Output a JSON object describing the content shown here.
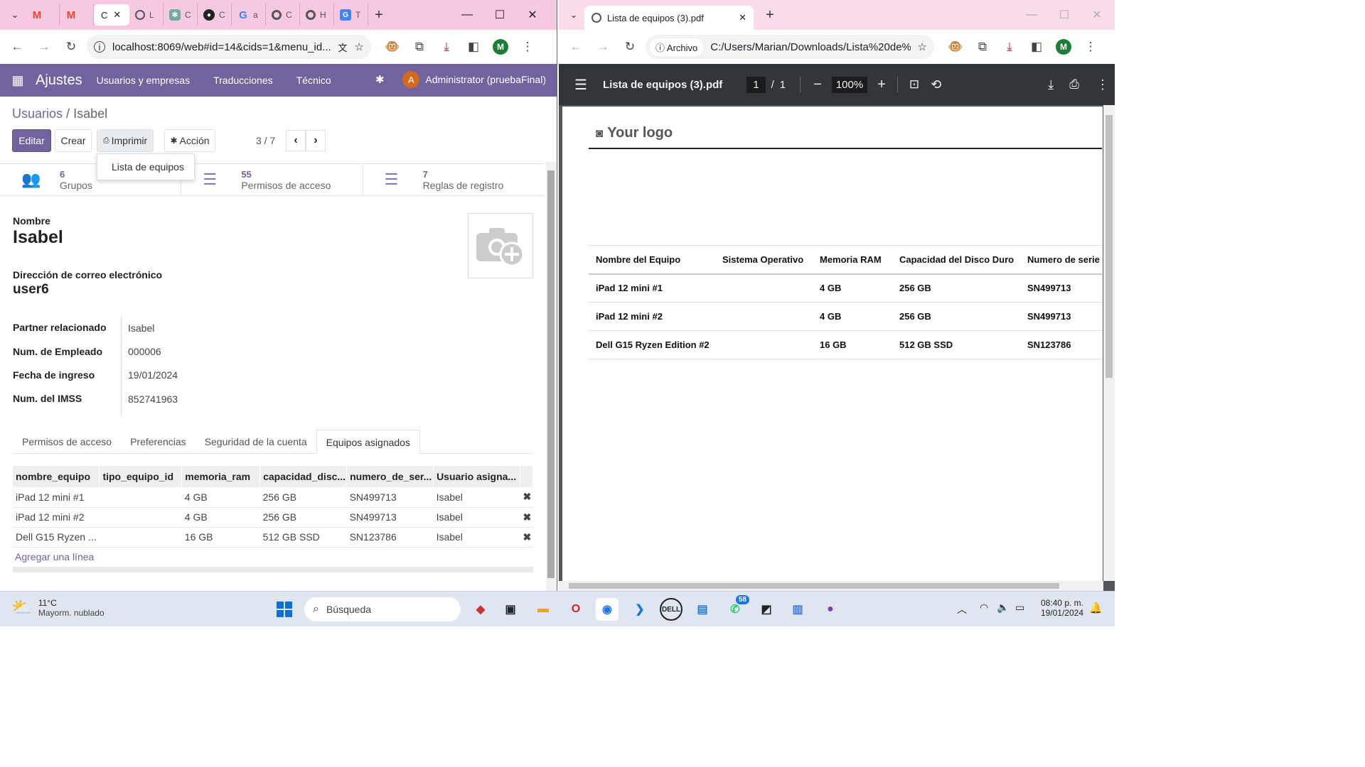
{
  "left_browser": {
    "tabs": [
      {
        "icon": "gmail-icon",
        "glyph": "M",
        "color": "#ea4335"
      },
      {
        "icon": "gmail-icon",
        "glyph": "M",
        "color": "#ea4335"
      },
      {
        "icon": "odoo-icon",
        "label": "C",
        "active": true
      },
      {
        "icon": "globe-icon",
        "label": "L"
      },
      {
        "icon": "chatgpt-icon",
        "label": "C"
      },
      {
        "icon": "github-icon",
        "label": "C"
      },
      {
        "icon": "google-icon",
        "label": "a"
      },
      {
        "icon": "circle-icon",
        "label": "C"
      },
      {
        "icon": "circle-icon",
        "label": "H"
      },
      {
        "icon": "translate-icon",
        "label": "T"
      }
    ],
    "address": "localhost:8069/web#id=14&cids=1&menu_id...",
    "profile_initial": "M"
  },
  "odoo": {
    "app_name": "Ajustes",
    "menus": [
      "Usuarios y empresas",
      "Traducciones",
      "Técnico"
    ],
    "user_initial": "A",
    "user_name": "Administrator (pruebaFinal)",
    "breadcrumb_parent": "Usuarios",
    "breadcrumb_sep": "/",
    "breadcrumb_current": "Isabel",
    "btn_edit": "Editar",
    "btn_create": "Crear",
    "btn_print": "Imprimir",
    "btn_action": "Acción",
    "pager": "3 / 7",
    "print_menu_item": "Lista de equipos",
    "stats": [
      {
        "num": "6",
        "label": "Grupos"
      },
      {
        "num": "55",
        "label": "Permisos de acceso"
      },
      {
        "num": "7",
        "label": "Reglas de registro"
      }
    ],
    "name_label": "Nombre",
    "name_value": "Isabel",
    "email_label": "Dirección de correo electrónico",
    "email_value": "user6",
    "fields": [
      {
        "label": "Partner relacionado",
        "value": "Isabel"
      },
      {
        "label": "Num. de Empleado",
        "value": "000006"
      },
      {
        "label": "Fecha de ingreso",
        "value": "19/01/2024"
      },
      {
        "label": "Num. del IMSS",
        "value": "852741963"
      }
    ],
    "notebook_tabs": [
      "Permisos de acceso",
      "Preferencias",
      "Seguridad de la cuenta",
      "Equipos asignados"
    ],
    "table_headers": [
      "nombre_equipo",
      "tipo_equipo_id",
      "memoria_ram",
      "capacidad_disc...",
      "numero_de_ser...",
      "Usuario asigna..."
    ],
    "table_rows": [
      [
        "iPad 12 mini #1",
        "",
        "4 GB",
        "256 GB",
        "SN499713",
        "Isabel"
      ],
      [
        "iPad 12 mini #2",
        "",
        "4 GB",
        "256 GB",
        "SN499713",
        "Isabel"
      ],
      [
        "Dell G15 Ryzen ...",
        "",
        "16 GB",
        "512 GB SSD",
        "SN123786",
        "Isabel"
      ]
    ],
    "add_line": "Agregar una línea"
  },
  "right_browser": {
    "tab_title": "Lista de equipos (3).pdf",
    "address_chip": "Archivo",
    "address": "C:/Users/Marian/Downloads/Lista%20de%...",
    "profile_initial": "M"
  },
  "pdf": {
    "title": "Lista de equipos (3).pdf",
    "page_current": "1",
    "page_sep": "/",
    "page_total": "1",
    "zoom": "100%",
    "logo_text": "Your logo",
    "headers": [
      "Nombre del Equipo",
      "Sistema Operativo",
      "Memoria RAM",
      "Capacidad del Disco Duro",
      "Numero de serie"
    ],
    "rows": [
      [
        "iPad 12 mini #1",
        "",
        "4 GB",
        "256 GB",
        "SN499713"
      ],
      [
        "iPad 12 mini #2",
        "",
        "4 GB",
        "256 GB",
        "SN499713"
      ],
      [
        "Dell G15 Ryzen Edition #2",
        "",
        "16 GB",
        "512 GB SSD",
        "SN123786"
      ]
    ]
  },
  "taskbar": {
    "temperature": "11°C",
    "weather": "Mayorm. nublado",
    "search_placeholder": "Búsqueda",
    "whatsapp_badge": "58",
    "time": "08:40 p. m.",
    "date": "19/01/2024"
  },
  "colors": {
    "odoo_primary": "#71639e",
    "chrome_tabstrip": "#f6c9e0",
    "pdf_toolbar": "#323639"
  }
}
